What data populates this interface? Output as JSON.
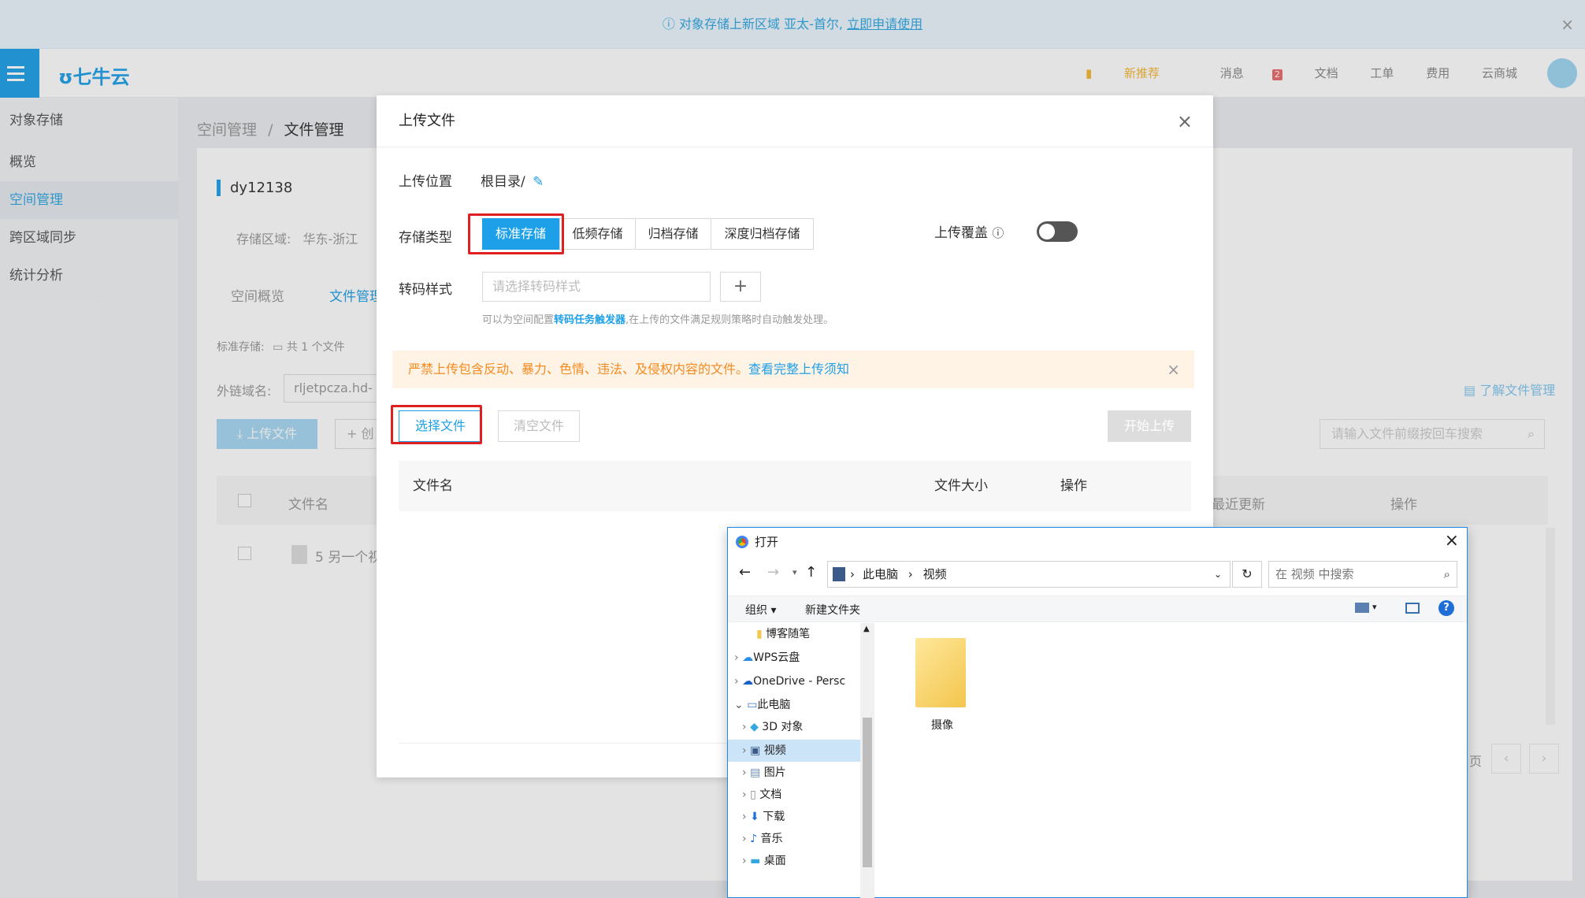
{
  "banner": {
    "text": "对象存储上新区域 亚太-首尔,",
    "link": "立即申请使用"
  },
  "topbar": {
    "logo": "七牛云",
    "nav": [
      "新推荐",
      "消息",
      "文档",
      "工单",
      "费用",
      "云商城"
    ],
    "msg_count": "2"
  },
  "sidebar": {
    "title": "对象存储",
    "items": [
      "概览",
      "空间管理",
      "跨区域同步",
      "统计分析"
    ],
    "active": "空间管理"
  },
  "page": {
    "breadcrumb_root": "空间管理",
    "breadcrumb_sep": "/",
    "breadcrumb_current": "文件管理",
    "bucket_name": "dy12138",
    "region_label": "存储区域:",
    "region_value": "华东-浙江",
    "tabs": [
      "空间概览",
      "文件管理"
    ],
    "storage_summary": "标准存储:",
    "file_count": "共 1 个文件",
    "domain_label": "外链域名:",
    "domain_value": "rljetpcza.hd-bk",
    "upload_btn": "上传文件",
    "create_btn": "+ 创",
    "learn_link": "了解文件管理",
    "search_placeholder": "请输入文件前缀按回车搜索",
    "col_filename": "文件名",
    "col_updated": "最近更新",
    "col_action": "操作",
    "row_name": "5 另一个视",
    "pager_text": "页"
  },
  "modal": {
    "title": "上传文件",
    "location_label": "上传位置",
    "location_value": "根目录/",
    "storage_label": "存储类型",
    "storage_types": [
      "标准存储",
      "低频存储",
      "归档存储",
      "深度归档存储"
    ],
    "overwrite_label": "上传覆盖",
    "transcode_label": "转码样式",
    "transcode_placeholder": "请选择转码样式",
    "hint_prefix": "可以为空间配置",
    "hint_link": "转码任务触发器",
    "hint_suffix": ",在上传的文件满足规则策略时自动触发处理。",
    "warning_text": "严禁上传包含反动、暴力、色情、违法、及侵权内容的文件。",
    "warning_link": "查看完整上传须知",
    "choose_btn": "选择文件",
    "clear_btn": "清空文件",
    "start_btn": "开始上传",
    "col_name": "文件名",
    "col_size": "文件大小",
    "col_action": "操作"
  },
  "file_dialog": {
    "title": "打开",
    "path": [
      "此电脑",
      "视频"
    ],
    "search_placeholder": "在 视频 中搜索",
    "organize": "组织 ▾",
    "new_folder": "新建文件夹",
    "tree": [
      "博客随笔",
      "WPS云盘",
      "OneDrive - Persc",
      "此电脑",
      "3D 对象",
      "视频",
      "图片",
      "文档",
      "下载",
      "音乐",
      "桌面"
    ],
    "folder_name": "摄像"
  },
  "colors": {
    "accent": "#1ea0e8",
    "warning": "#f58a1f",
    "highlight": "#e02020"
  }
}
